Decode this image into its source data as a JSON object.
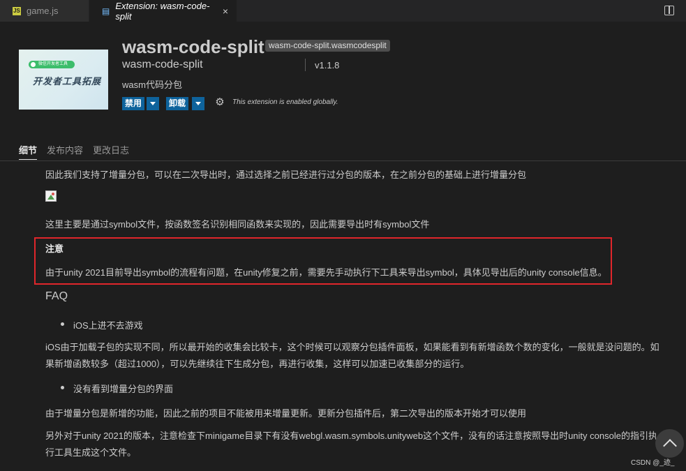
{
  "tabs": [
    {
      "label": "game.js",
      "icon": "js-file-icon"
    },
    {
      "label": "Extension: wasm-code-split",
      "icon": "extension-doc-icon"
    }
  ],
  "close_glyph": "×",
  "extension": {
    "logo_pill": "微信开发者工具",
    "logo_text": "开发者工具拓展",
    "name": "wasm-code-split",
    "identifier": "wasm-code-split.wasmcodesplit",
    "publisher": "wasm-code-split",
    "version": "v1.1.8",
    "description": "wasm代码分包",
    "disable_label": "禁用",
    "uninstall_label": "卸载",
    "status_note": "This extension is enabled globally."
  },
  "nav_tabs": [
    "细节",
    "发布内容",
    "更改日志"
  ],
  "content": {
    "line1": "因此我们支持了增量分包，可以在二次导出时，通过选择之前已经进行过分包的版本，在之前分包的基础上进行增量分包",
    "line2": "这里主要是通过symbol文件，按函数签名识别相同函数来实现的，因此需要导出时有symbol文件",
    "note_title": "注意",
    "note_text": "由于unity 2021目前导出symbol的流程有问题，在unity修复之前，需要先手动执行下工具来导出symbol，具体见导出后的unity console信息。",
    "faq_heading": "FAQ",
    "bullet1": "iOS上进不去游戏",
    "para1": "iOS由于加载子包的实现不同，所以最开始的收集会比较卡，这个时候可以观察分包插件面板，如果能看到有新增函数个数的变化，一般就是没问题的。如果新增函数较多（超过1000），可以先继续往下生成分包，再进行收集，这样可以加速已收集部分的运行。",
    "bullet2": "没有看到增量分包的界面",
    "para2": "由于增量分包是新增的功能，因此之前的项目不能被用来增量更新。更新分包插件后，第二次导出的版本开始才可以使用",
    "para3": "另外对于unity 2021的版本，注意检查下minigame目录下有没有webgl.wasm.symbols.unityweb这个文件，没有的话注意按照导出时unity console的指引执行工具生成这个文件。"
  },
  "watermark": "CSDN @_迹_"
}
